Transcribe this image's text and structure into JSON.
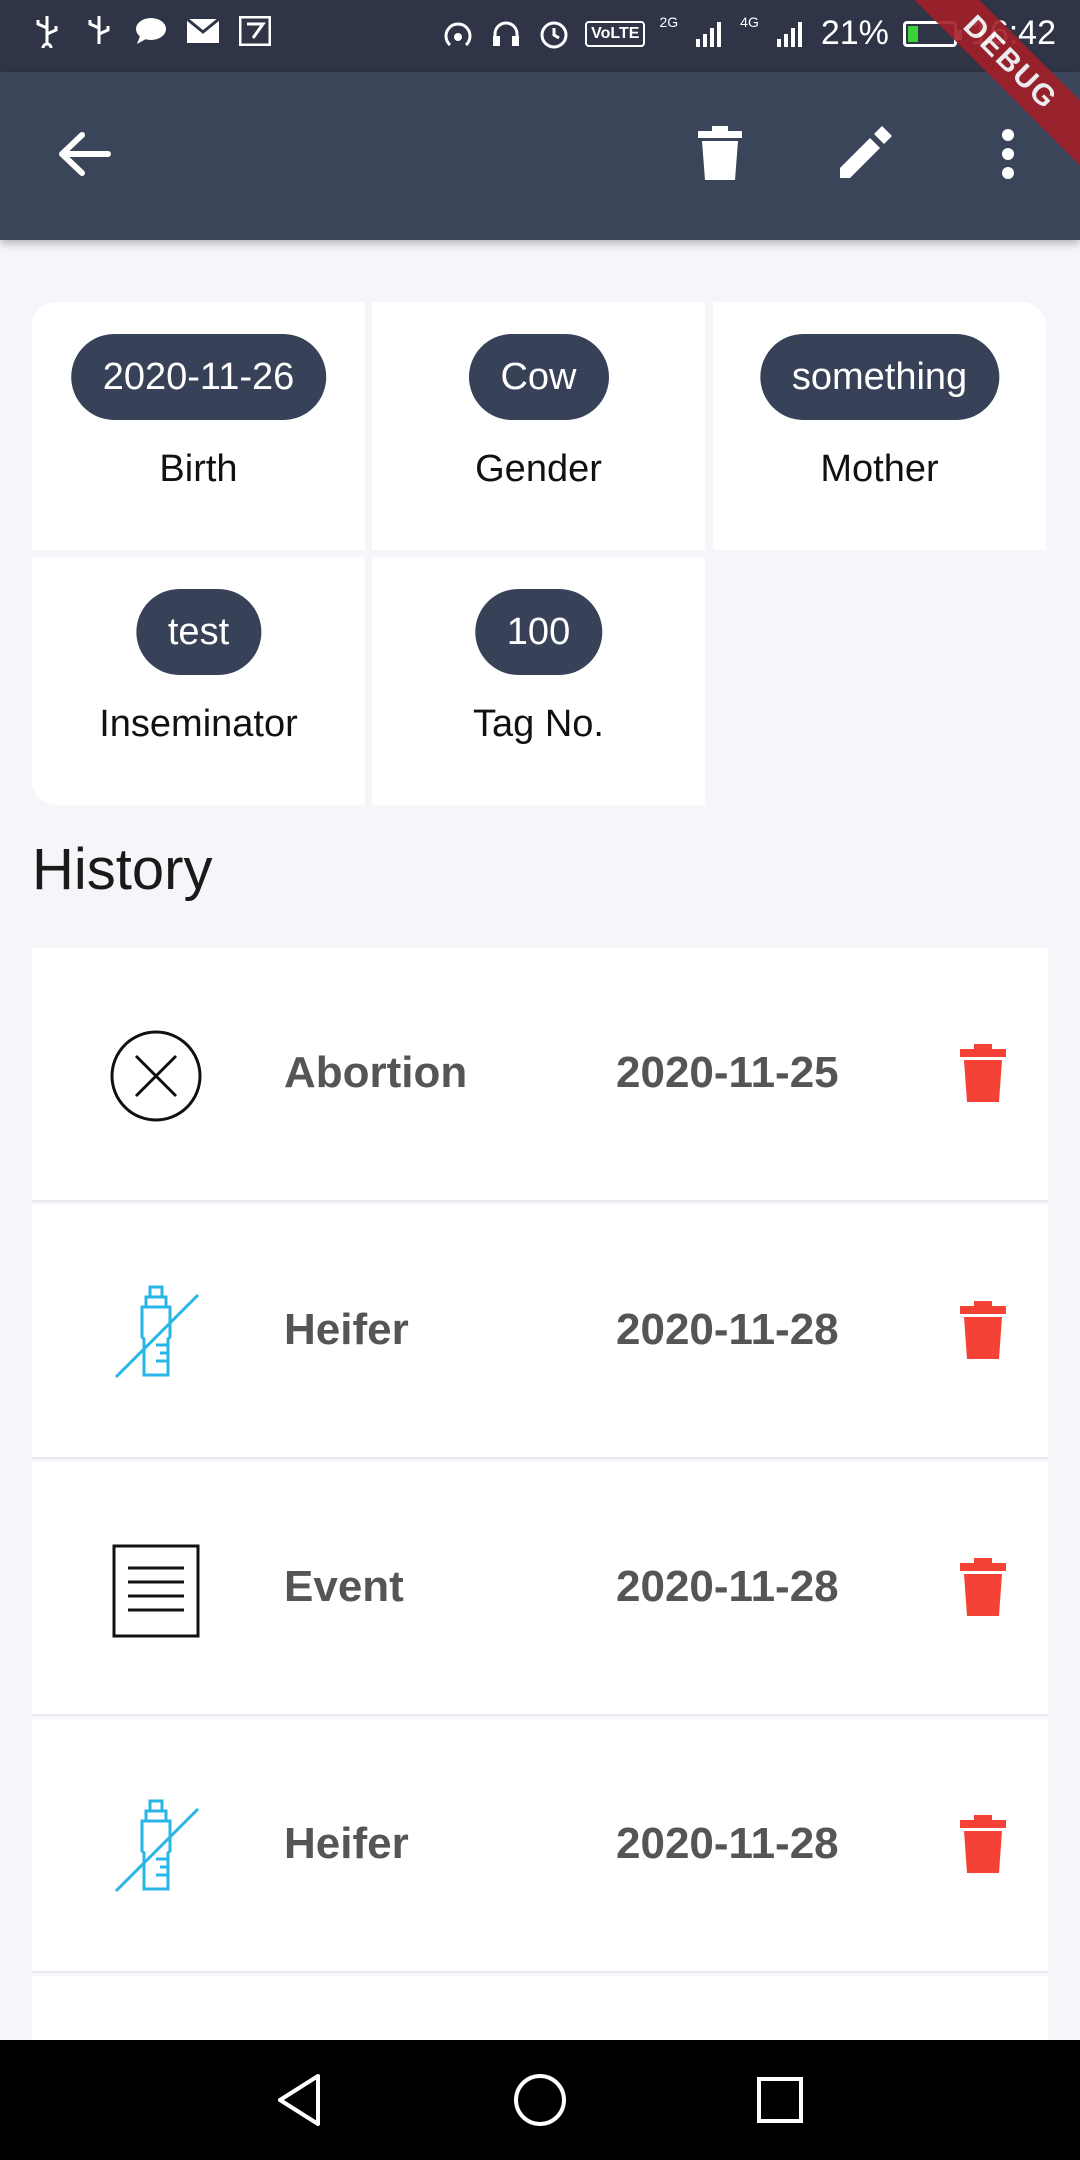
{
  "status_bar": {
    "volte": "VoLTE",
    "net1": "2G",
    "net2": "4G",
    "battery": "21%",
    "time": "16:42",
    "battery_color": "#3ad13a"
  },
  "debug_banner": "DEBUG",
  "app_bar": {
    "back_icon": "arrow-back-icon",
    "delete_icon": "trash-icon",
    "edit_icon": "pencil-icon",
    "more_icon": "more-vert-icon",
    "background": "#3b4559"
  },
  "info": [
    {
      "value": "2020-11-26",
      "label": "Birth"
    },
    {
      "value": "Cow",
      "label": "Gender"
    },
    {
      "value": "something",
      "label": "Mother"
    },
    {
      "value": "test",
      "label": "Inseminator"
    },
    {
      "value": "100",
      "label": "Tag No."
    }
  ],
  "history": {
    "title": "History",
    "items": [
      {
        "icon": "abortion-circle-x-icon",
        "name": "Abortion",
        "date": "2020-11-25"
      },
      {
        "icon": "heifer-bottle-icon",
        "name": "Heifer",
        "date": "2020-11-28"
      },
      {
        "icon": "event-document-icon",
        "name": "Event",
        "date": "2020-11-28"
      },
      {
        "icon": "heifer-bottle-icon",
        "name": "Heifer",
        "date": "2020-11-28"
      }
    ],
    "delete_color": "#f44336",
    "heifer_icon_color": "#29b6e6"
  }
}
